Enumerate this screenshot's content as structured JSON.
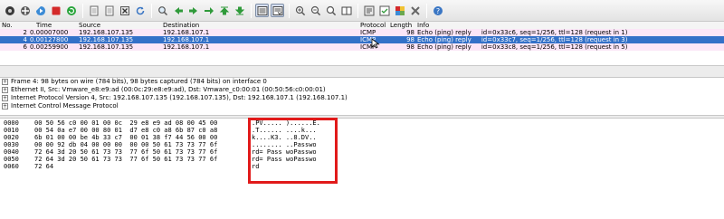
{
  "toolbar": {
    "icons": [
      "interface-list-icon",
      "capture-options-icon",
      "start-capture-icon",
      "stop-capture-icon",
      "restart-capture-icon",
      "open-file-icon",
      "save-file-icon",
      "close-file-icon",
      "reload-icon",
      "print-icon",
      "find-packet-icon",
      "go-back-icon",
      "go-forward-icon",
      "go-to-packet-icon",
      "go-first-icon",
      "go-last-icon",
      "colorize-icon",
      "auto-scroll-icon",
      "zoom-in-icon",
      "zoom-out-icon",
      "zoom-normal-icon",
      "resize-columns-icon",
      "capture-filters-icon",
      "display-filters-icon",
      "coloring-rules-icon",
      "preferences-icon",
      "help-icon"
    ]
  },
  "packet_list": {
    "headers": {
      "no": "No.",
      "time": "Time",
      "source": "Source",
      "destination": "Destination",
      "protocol": "Protocol",
      "length": "Length",
      "info": "Info"
    },
    "rows": [
      {
        "no": "2",
        "time": "0.00007000",
        "source": "192.168.107.135",
        "destination": "192.168.107.1",
        "protocol": "ICMP",
        "length": "98",
        "info": "Echo (ping) reply     id=0x33c6, seq=1/256, ttl=128 (request in 1)"
      },
      {
        "no": "4",
        "time": "0.00127800",
        "source": "192.168.107.135",
        "destination": "192.168.107.1",
        "protocol": "ICMP",
        "length": "98",
        "info": "Echo (ping) reply     id=0x33c7, seq=1/256, ttl=128 (request in 3)"
      },
      {
        "no": "6",
        "time": "0.00259900",
        "source": "192.168.107.135",
        "destination": "192.168.107.1",
        "protocol": "ICMP",
        "length": "98",
        "info": "Echo (ping) reply     id=0x33c8, seq=1/256, ttl=128 (request in 5)"
      }
    ],
    "colors": {
      "row_bg": "#fbe6f7",
      "selected_bg": "#3371c8"
    }
  },
  "details": {
    "rows": [
      {
        "expander": "+",
        "text": "Frame 4: 98 bytes on wire (784 bits), 98 bytes captured (784 bits) on interface 0"
      },
      {
        "expander": "+",
        "text": "Ethernet II, Src: Vmware_e8:e9:ad (00:0c:29:e8:e9:ad), Dst: Vmware_c0:00:01 (00:50:56:c0:00:01)"
      },
      {
        "expander": "+",
        "text": "Internet Protocol Version 4, Src: 192.168.107.135 (192.168.107.135), Dst: 192.168.107.1 (192.168.107.1)"
      },
      {
        "expander": "+",
        "text": "Internet Control Message Protocol"
      }
    ]
  },
  "hex_dump": {
    "rows": [
      {
        "offset": "0000",
        "bytes": "00 50 56 c0 00 01 00 0c  29 e8 e9 ad 08 00 45 00",
        "ascii": ".PV..... )......E."
      },
      {
        "offset": "0010",
        "bytes": "00 54 0a e7 00 00 80 01  d7 e8 c0 a8 6b 87 c0 a8",
        "ascii": ".T...... ....k..."
      },
      {
        "offset": "0020",
        "bytes": "6b 01 00 00 be 4b 33 c7  00 01 38 f7 44 56 00 00",
        "ascii": "k....K3. ..8.DV.."
      },
      {
        "offset": "0030",
        "bytes": "00 00 92 db 04 00 00 00  00 00 50 61 73 73 77 6f",
        "ascii": "........ ..Passwo"
      },
      {
        "offset": "0040",
        "bytes": "72 64 3d 20 50 61 73 73  77 6f 50 61 73 73 77 6f",
        "ascii": "rd= Pass woPasswo"
      },
      {
        "offset": "0050",
        "bytes": "72 64 3d 20 50 61 73 73  77 6f 50 61 73 73 77 6f",
        "ascii": "rd= Pass woPasswo"
      },
      {
        "offset": "0060",
        "bytes": "72 64",
        "ascii": "rd"
      }
    ],
    "highlight_color": "#e11a1a"
  }
}
